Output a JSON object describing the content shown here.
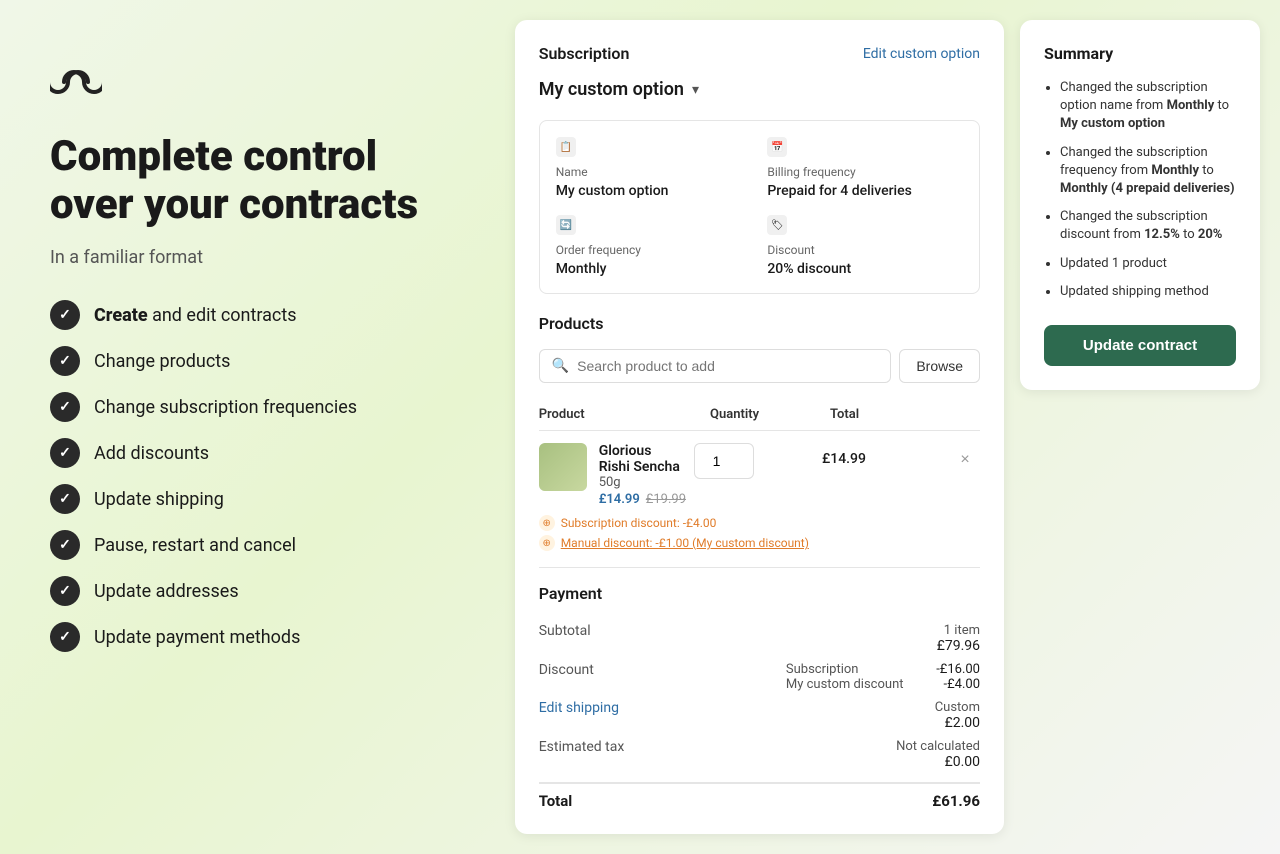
{
  "logo": {
    "icon": "∞",
    "alt": "logo"
  },
  "hero": {
    "title": "Complete control over your contracts",
    "subtitle": "In a familiar format"
  },
  "features": [
    {
      "bold": "Create",
      "rest": " and edit contracts"
    },
    {
      "bold": "",
      "rest": "Change products"
    },
    {
      "bold": "",
      "rest": "Change subscription frequencies"
    },
    {
      "bold": "",
      "rest": "Add discounts"
    },
    {
      "bold": "",
      "rest": "Update shipping"
    },
    {
      "bold": "",
      "rest": "Pause, restart and cancel"
    },
    {
      "bold": "",
      "rest": "Update addresses"
    },
    {
      "bold": "",
      "rest": "Update payment methods"
    }
  ],
  "subscription": {
    "section_title": "Subscription",
    "edit_link": "Edit custom option",
    "selected_option": "My custom option",
    "details": {
      "name_label": "Name",
      "name_value": "My custom option",
      "billing_label": "Billing frequency",
      "billing_value": "Prepaid for 4 deliveries",
      "order_label": "Order frequency",
      "order_value": "Monthly",
      "discount_label": "Discount",
      "discount_value": "20% discount"
    }
  },
  "products": {
    "section_title": "Products",
    "search_placeholder": "Search product to add",
    "browse_label": "Browse",
    "table_headers": {
      "product": "Product",
      "quantity": "Quantity",
      "total": "Total"
    },
    "items": [
      {
        "name": "Glorious Rishi Sencha",
        "size": "50g",
        "price_current": "£14.99",
        "price_original": "£19.99",
        "quantity": "1",
        "total": "£14.99",
        "discounts": [
          {
            "label": "Subscription discount: -£4.00",
            "type": "sub"
          },
          {
            "label": "Manual discount: -£1.00 (My custom discount)",
            "type": "manual"
          }
        ]
      }
    ]
  },
  "payment": {
    "section_title": "Payment",
    "subtotal_label": "Subtotal",
    "subtotal_items": "1 item",
    "subtotal_value": "£79.96",
    "discount_label": "Discount",
    "discount_sub1_label": "Subscription",
    "discount_sub1_value": "-£16.00",
    "discount_sub2_label": "My custom discount",
    "discount_sub2_value": "-£4.00",
    "shipping_label": "Edit shipping",
    "shipping_type": "Custom",
    "shipping_value": "£2.00",
    "tax_label": "Estimated tax",
    "tax_value_label": "Not calculated",
    "tax_value": "£0.00",
    "total_label": "Total",
    "total_value": "£61.96"
  },
  "summary": {
    "title": "Summary",
    "items": [
      {
        "text": "Changed the subscription option name from ",
        "from": "Monthly",
        "connector": " to ",
        "to": "My custom option"
      },
      {
        "text": "Changed the subscription frequency from ",
        "from": "Monthly",
        "connector": " to ",
        "to": "Monthly (4 prepaid deliveries)"
      },
      {
        "text": "Changed the subscription discount from ",
        "from": "12.5%",
        "connector": " to ",
        "to": "20%"
      },
      {
        "text": "Updated 1 product",
        "from": "",
        "connector": "",
        "to": ""
      },
      {
        "text": "Updated shipping method",
        "from": "",
        "connector": "",
        "to": ""
      }
    ],
    "update_btn": "Update contract"
  }
}
